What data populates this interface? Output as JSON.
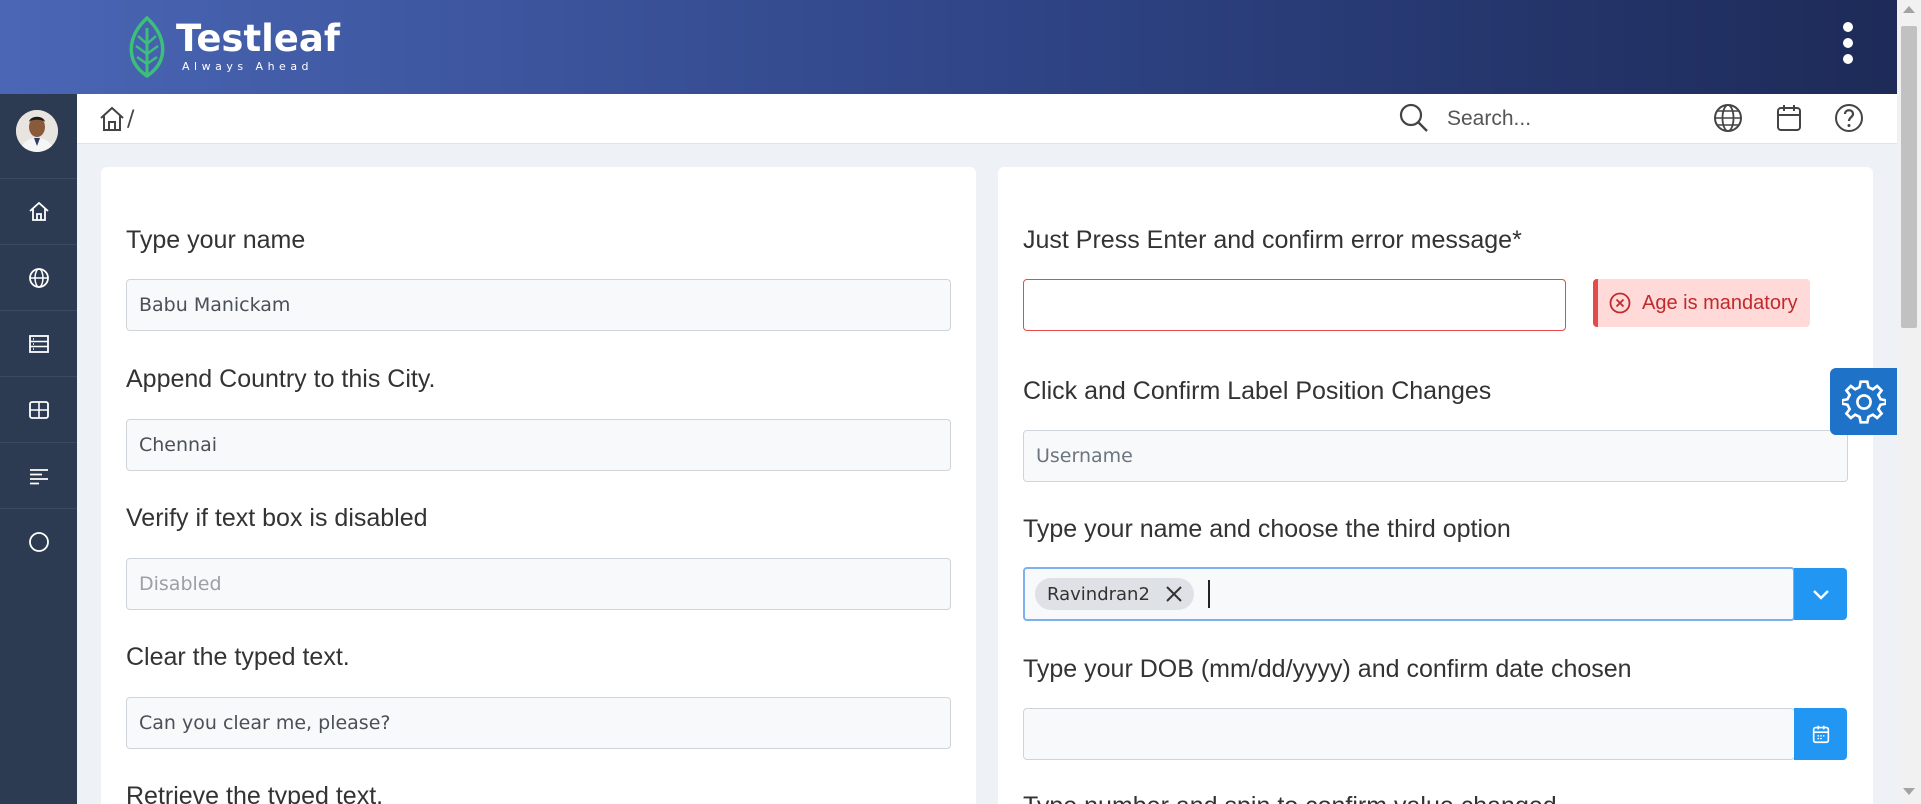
{
  "header": {
    "logo_title": "Testleaf",
    "logo_subtitle": "Always Ahead",
    "brand_green": "#3cbf7a"
  },
  "sidebar": {
    "items": [
      {
        "icon": "home-icon"
      },
      {
        "icon": "globe-icon"
      },
      {
        "icon": "server-icon"
      },
      {
        "icon": "table-icon"
      },
      {
        "icon": "list-icon"
      },
      {
        "icon": "circle-icon"
      }
    ]
  },
  "subheader": {
    "breadcrumb_sep": "/",
    "search_placeholder": "Search..."
  },
  "left_form": {
    "name_label": "Type your name",
    "name_value": "Babu Manickam",
    "append_label": "Append Country to this City.",
    "append_value": "Chennai",
    "disabled_label": "Verify if text box is disabled",
    "disabled_value": "Disabled",
    "clear_label": "Clear the typed text.",
    "clear_value": "Can you clear me, please?",
    "retrieve_label": "Retrieve the typed text."
  },
  "right_form": {
    "enter_label": "Just Press Enter and confirm error message*",
    "enter_value": "",
    "error_message": "Age is mandatory",
    "position_label": "Click and Confirm Label Position Changes",
    "position_placeholder": "Username",
    "autocomplete_label": "Type your name and choose the third option",
    "chip_value": "Ravindran2",
    "dob_label": "Type your DOB (mm/dd/yyyy) and confirm date chosen",
    "dob_value": "",
    "next_label": "Type number and spin to confirm value changed"
  },
  "colors": {
    "accent": "#2196f3",
    "error": "#e24c4c",
    "sidebar_bg": "#2c3a52"
  }
}
